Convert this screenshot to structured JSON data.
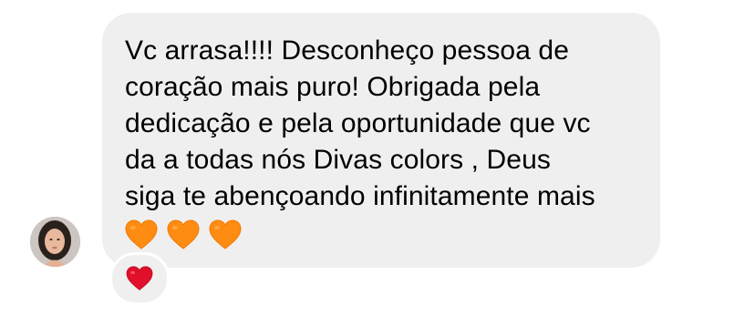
{
  "message": {
    "text": "Vc arrasa!!!! Desconheço pessoa de\ncoração mais puro! Obrigada pela\ndedicação e pela oportunidade que vc\nda a todas nós Divas colors , Deus\nsiga te abençoando infinitamente mais",
    "emoji": [
      "orange-heart",
      "orange-heart",
      "orange-heart"
    ],
    "bubble_color": "#efefef"
  },
  "reaction": {
    "emoji": "red-heart",
    "color": "#e0102a"
  },
  "avatar": {
    "icon": "profile-photo"
  },
  "colors": {
    "orange_heart": "#fe8c12",
    "orange_heart_shade": "#f07a00",
    "red_heart": "#e0102a"
  }
}
